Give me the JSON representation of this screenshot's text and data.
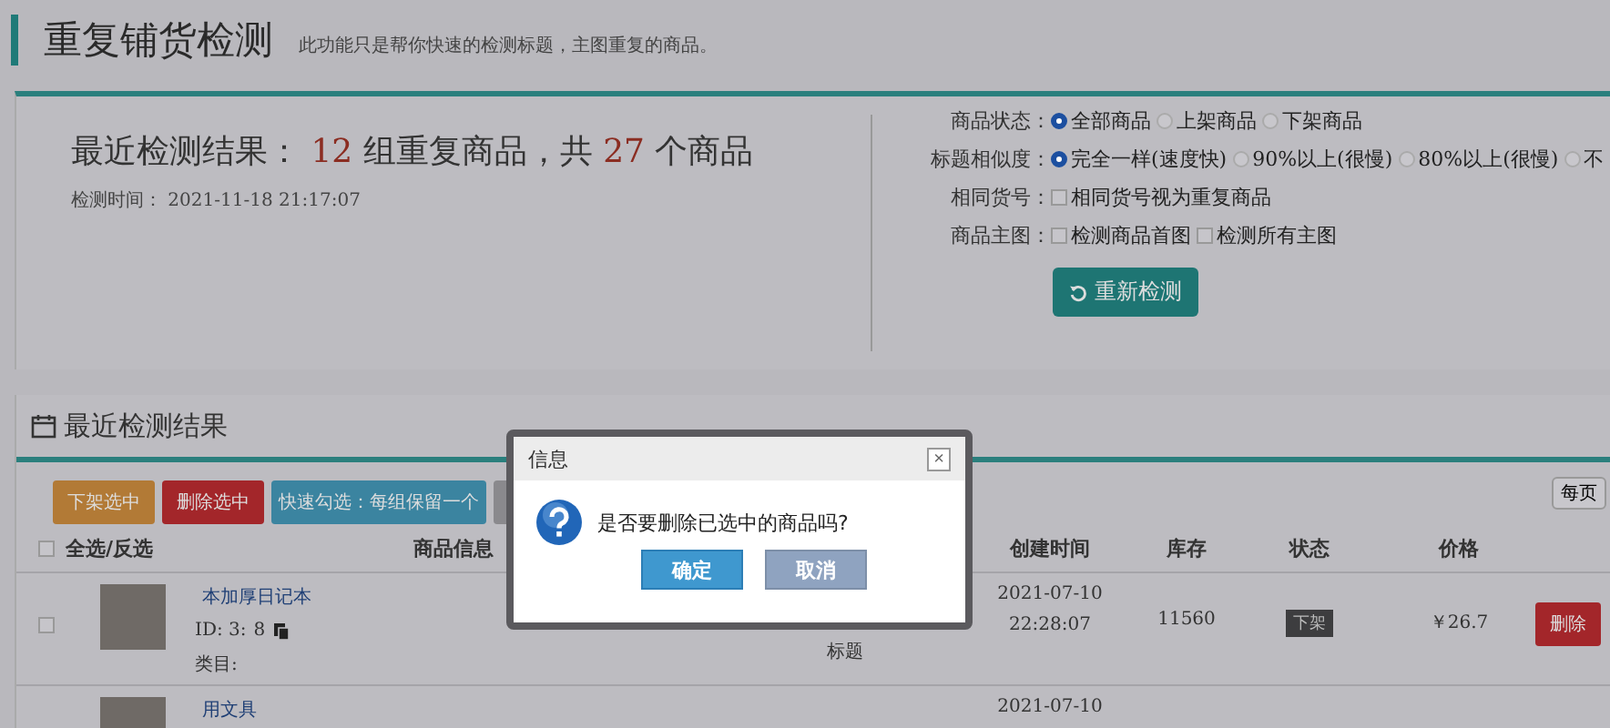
{
  "page_header": {
    "title": "重复铺货检测",
    "subtitle": "此功能只是帮你快速的检测标题，主图重复的商品。"
  },
  "summary": {
    "heading": "最近检测结果：",
    "groups": "12",
    "middle": "组重复商品，共",
    "total": "27",
    "tail": "个商品",
    "time_label": "检测时间：",
    "time": "2021-11-18 21:17:07"
  },
  "settings": [
    {
      "label": "商品状态：",
      "kind": "radio",
      "options": [
        {
          "label": "全部商品",
          "selected": true
        },
        {
          "label": "上架商品",
          "selected": false
        },
        {
          "label": "下架商品",
          "selected": false
        }
      ]
    },
    {
      "label": "标题相似度：",
      "kind": "radio",
      "options": [
        {
          "label": "完全一样(速度快)",
          "selected": true
        },
        {
          "label": "90%以上(很慢)",
          "selected": false
        },
        {
          "label": "80%以上(很慢)",
          "selected": false
        },
        {
          "label": "不",
          "selected": false
        }
      ]
    },
    {
      "label": "相同货号：",
      "kind": "checkbox",
      "options": [
        {
          "label": "相同货号视为重复商品",
          "checked": false
        }
      ]
    },
    {
      "label": "商品主图：",
      "kind": "checkbox",
      "options": [
        {
          "label": "检测商品首图",
          "checked": false
        },
        {
          "label": "检测所有主图",
          "checked": false
        }
      ]
    }
  ],
  "recheck_button": "重新检测",
  "results": {
    "title": "最近检测结果",
    "actions": [
      {
        "label": "下架选中",
        "color": "#b27a36"
      },
      {
        "label": "删除选中",
        "color": "#a3262a"
      },
      {
        "label": "快速勾选：每组保留一个",
        "color": "#3b84a0"
      },
      {
        "color": "#8a898d"
      }
    ],
    "page_size_button": "每页",
    "select_all": {
      "label": "全选/反选",
      "checked": false
    },
    "columns": [
      "商品信息",
      "",
      "创建时间",
      "库存",
      "状态",
      "价格"
    ],
    "rows": [
      {
        "checked": false,
        "title": "本加厚日记本",
        "id": "ID: 3:",
        "id_tail": "8",
        "category": "类目:",
        "match": "标题",
        "created_date": "2021-07-10",
        "created_time": "22:28:07",
        "stock": "11560",
        "status": "下架",
        "price": "￥26.7",
        "delete": "删除"
      },
      {
        "title": "用文具",
        "created_date": "2021-07-10"
      }
    ]
  },
  "dialog": {
    "title": "信息",
    "close": "×",
    "message": "是否要删除已选中的商品吗?",
    "buttons": [
      {
        "label": "确定",
        "kind": "primary"
      },
      {
        "label": "取消",
        "kind": "secondary"
      }
    ]
  }
}
